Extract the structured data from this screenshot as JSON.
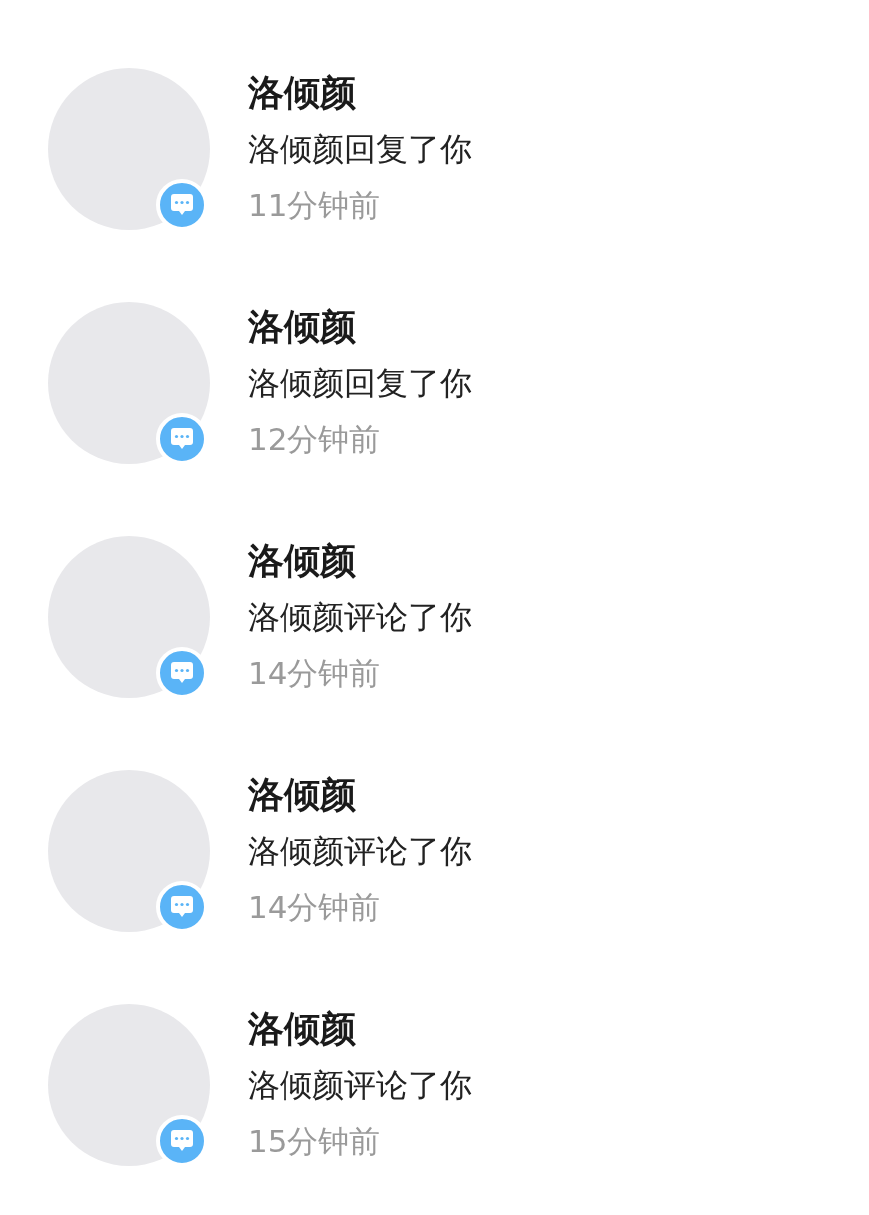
{
  "notifications": [
    {
      "name": "洛倾颜",
      "message": "洛倾颜回复了你",
      "time": "11分钟前"
    },
    {
      "name": "洛倾颜",
      "message": "洛倾颜回复了你",
      "time": "12分钟前"
    },
    {
      "name": "洛倾颜",
      "message": "洛倾颜评论了你",
      "time": "14分钟前"
    },
    {
      "name": "洛倾颜",
      "message": "洛倾颜评论了你",
      "time": "14分钟前"
    },
    {
      "name": "洛倾颜",
      "message": "洛倾颜评论了你",
      "time": "15分钟前"
    }
  ]
}
